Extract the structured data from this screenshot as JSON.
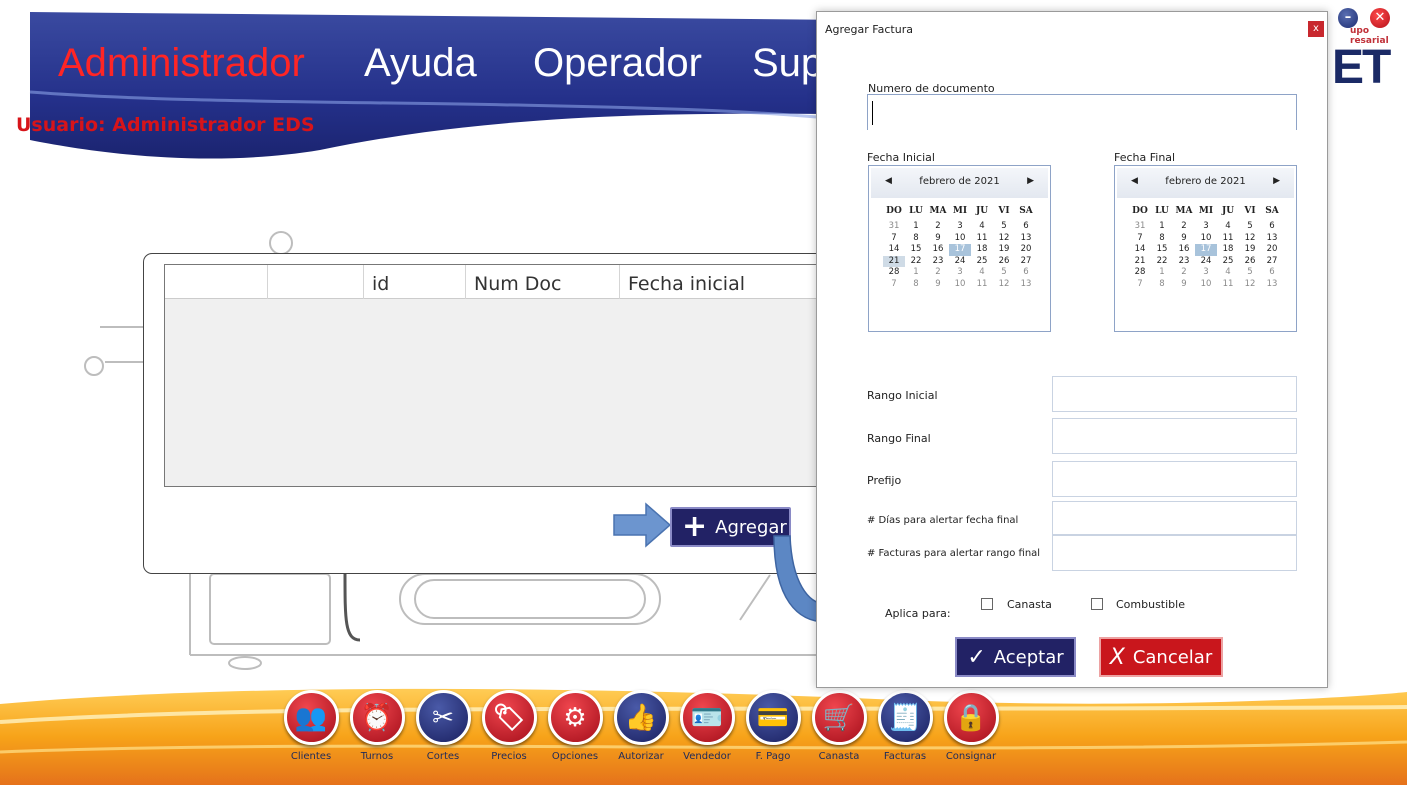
{
  "menu": {
    "administrador": "Administrador",
    "ayuda": "Ayuda",
    "operador": "Operador",
    "sup": "Sup"
  },
  "user_label": "Usuario: Administrador EDS",
  "brand": {
    "mini": "upo\nresarial",
    "big": "ET"
  },
  "window_controls": {
    "minimize": "–",
    "close": "✕"
  },
  "grid": {
    "columns": [
      "",
      "",
      "id",
      "Num Doc",
      "Fecha inicial"
    ],
    "rows": []
  },
  "agregar_button": {
    "label": "Agregar",
    "icon": "plus-icon"
  },
  "toolbar": [
    {
      "label": "Clientes",
      "icon": "users-icon",
      "color": "red",
      "glyph": "👥"
    },
    {
      "label": "Turnos",
      "icon": "alarm-clock-icon",
      "color": "red",
      "glyph": "⏰"
    },
    {
      "label": "Cortes",
      "icon": "scissors-icon",
      "color": "blue",
      "glyph": "✂"
    },
    {
      "label": "Precios",
      "icon": "price-tag-icon",
      "color": "red",
      "glyph": "🏷"
    },
    {
      "label": "Opciones",
      "icon": "gears-icon",
      "color": "red",
      "glyph": "⚙"
    },
    {
      "label": "Autorizar",
      "icon": "thumbs-up-icon",
      "color": "blue",
      "glyph": "👍"
    },
    {
      "label": "Vendedor",
      "icon": "id-card-icon",
      "color": "red",
      "glyph": "🪪"
    },
    {
      "label": "F. Pago",
      "icon": "payment-icon",
      "color": "blue",
      "glyph": "💳"
    },
    {
      "label": "Canasta",
      "icon": "cart-icon",
      "color": "red",
      "glyph": "🛒"
    },
    {
      "label": "Facturas",
      "icon": "invoice-icon",
      "color": "blue",
      "glyph": "🧾"
    },
    {
      "label": "Consignar",
      "icon": "safe-icon",
      "color": "red",
      "glyph": "🔒"
    }
  ],
  "dialog": {
    "title": "Agregar Factura",
    "close": "x",
    "numero_documento_label": "Numero de documento",
    "numero_documento_value": "",
    "fecha_inicial_label": "Fecha Inicial",
    "fecha_final_label": "Fecha Final",
    "calendar": {
      "month": "febrero de 2021",
      "prev": "◀",
      "next": "▶",
      "dow": [
        "DO",
        "LU",
        "MA",
        "MI",
        "JU",
        "VI",
        "SA"
      ],
      "weeks": [
        [
          "31",
          "1",
          "2",
          "3",
          "4",
          "5",
          "6"
        ],
        [
          "7",
          "8",
          "9",
          "10",
          "11",
          "12",
          "13"
        ],
        [
          "14",
          "15",
          "16",
          "17",
          "18",
          "19",
          "20"
        ],
        [
          "21",
          "22",
          "23",
          "24",
          "25",
          "26",
          "27"
        ],
        [
          "28",
          "1",
          "2",
          "3",
          "4",
          "5",
          "6"
        ],
        [
          "7",
          "8",
          "9",
          "10",
          "11",
          "12",
          "13"
        ]
      ],
      "today": "17"
    },
    "rango_inicial_label": "Rango Inicial",
    "rango_final_label": "Rango Final",
    "prefijo_label": "Prefijo",
    "dias_label": "# Días para alertar fecha final",
    "facturas_label": "# Facturas para alertar rango final",
    "aplica_label": "Aplica para:",
    "canasta_label": "Canasta",
    "combustible_label": "Combustible",
    "aceptar_label": "Aceptar",
    "aceptar_icon": "✓",
    "cancelar_label": "Cancelar",
    "cancelar_icon": "X"
  },
  "colors": {
    "header_blue": "#2a3689",
    "menu_active": "#ff2525",
    "user_label": "#d7141a",
    "button_blue": "#222265",
    "button_red": "#c9161c"
  }
}
